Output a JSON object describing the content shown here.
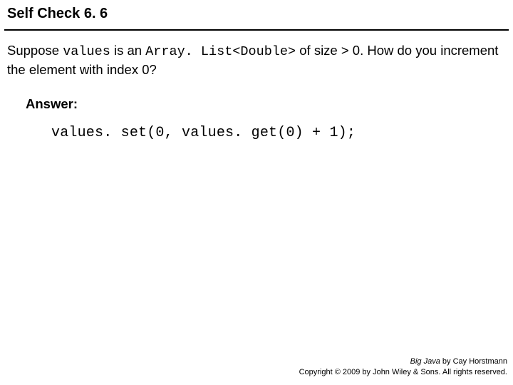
{
  "title": "Self Check 6. 6",
  "question": {
    "p1": "Suppose ",
    "c1": "values",
    "p2": " is an ",
    "c2": "Array. List<Double>",
    "p3": " of size > 0. How do you increment the element with index 0?"
  },
  "answer_label": "Answer:",
  "answer_code": "values. set(0, values. get(0) + 1);",
  "footer": {
    "book": "Big Java",
    "author": " by Cay Horstmann",
    "copyright": "Copyright © 2009 by John Wiley & Sons. All rights reserved."
  }
}
